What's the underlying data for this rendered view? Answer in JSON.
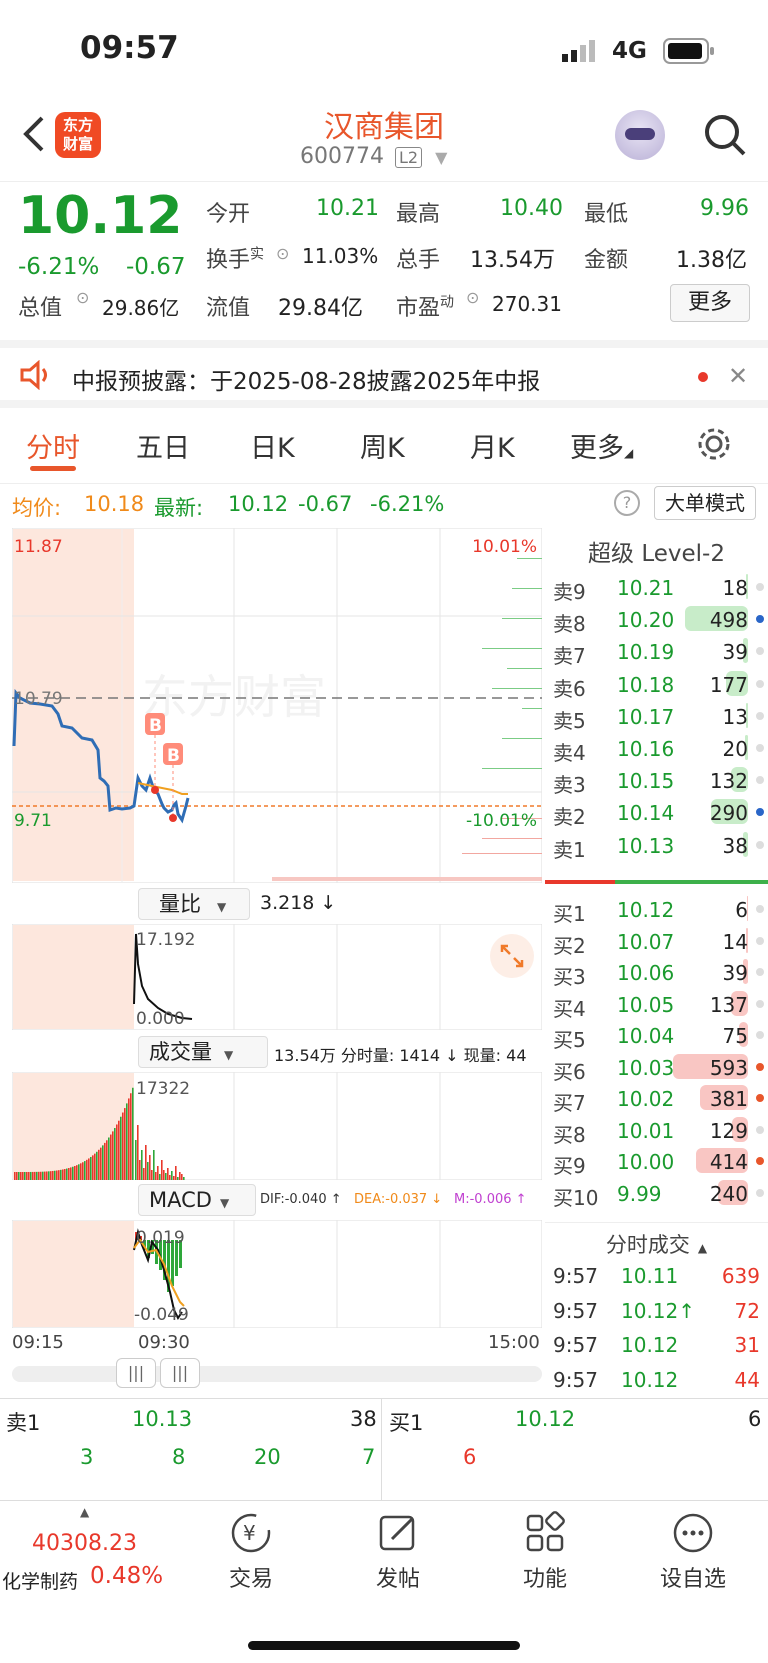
{
  "status": {
    "time": "09:57",
    "network": "4G"
  },
  "header": {
    "title": "汉商集团",
    "code": "600774",
    "badge": "L2",
    "logo_text": "东方财富"
  },
  "quote": {
    "price": "10.12",
    "change_pct": "-6.21%",
    "change": "-0.67",
    "open_label": "今开",
    "open": "10.21",
    "high_label": "最高",
    "high": "10.40",
    "low_label": "最低",
    "low": "9.96",
    "turnover_label": "换手",
    "turnover_sup": "实",
    "turnover": "11.03%",
    "volume_label": "总手",
    "volume": "13.54万",
    "amount_label": "金额",
    "amount": "1.38亿",
    "mktcap_label": "总值",
    "mktcap": "29.86亿",
    "float_label": "流值",
    "float": "29.84亿",
    "pe_label": "市盈",
    "pe_sup": "动",
    "pe": "270.31",
    "more_label": "更多"
  },
  "notice": {
    "text": "中报预披露：于2025-08-28披露2025年中报"
  },
  "tabs": [
    "分时",
    "五日",
    "日K",
    "周K",
    "月K",
    "更多"
  ],
  "avgline": {
    "avg_label": "均价:",
    "avg": "10.18",
    "last_label": "最新:",
    "last": "10.12",
    "chg": "-0.67",
    "pct": "-6.21%",
    "mode_label": "大单模式"
  },
  "chart": {
    "max_price": "11.87",
    "min_price": "9.71",
    "max_pct": "10.01%",
    "min_pct": "-10.01%",
    "ref_price": "10.79",
    "watermark": "东方财富",
    "vr_label": "量比",
    "vr_value": "3.218 ↓",
    "vr_max": "17.192",
    "vr_min": "0.000",
    "vol_label": "成交量",
    "vol_info": "13.54万 分时量: 1414 ↓ 现量: 44",
    "vol_max": "17322",
    "macd_label": "MACD",
    "dif": "DIF:-0.040 ↑",
    "dea": "DEA:-0.037 ↓",
    "m": "M:-0.006 ↑",
    "macd_max": "0.019",
    "macd_min": "-0.049",
    "t_start": "09:15",
    "t_open": "09:30",
    "t_end": "15:00",
    "marker": "B"
  },
  "level2": {
    "title": "超级 Level-2",
    "asks": [
      {
        "label": "卖9",
        "price": "10.21",
        "vol": "18"
      },
      {
        "label": "卖8",
        "price": "10.20",
        "vol": "498"
      },
      {
        "label": "卖7",
        "price": "10.19",
        "vol": "39"
      },
      {
        "label": "卖6",
        "price": "10.18",
        "vol": "177"
      },
      {
        "label": "卖5",
        "price": "10.17",
        "vol": "13"
      },
      {
        "label": "卖4",
        "price": "10.16",
        "vol": "20"
      },
      {
        "label": "卖3",
        "price": "10.15",
        "vol": "132"
      },
      {
        "label": "卖2",
        "price": "10.14",
        "vol": "290"
      },
      {
        "label": "卖1",
        "price": "10.13",
        "vol": "38"
      }
    ],
    "bids": [
      {
        "label": "买1",
        "price": "10.12",
        "vol": "6"
      },
      {
        "label": "买2",
        "price": "10.07",
        "vol": "14"
      },
      {
        "label": "买3",
        "price": "10.06",
        "vol": "39"
      },
      {
        "label": "买4",
        "price": "10.05",
        "vol": "137"
      },
      {
        "label": "买5",
        "price": "10.04",
        "vol": "75"
      },
      {
        "label": "买6",
        "price": "10.03",
        "vol": "593"
      },
      {
        "label": "买7",
        "price": "10.02",
        "vol": "381"
      },
      {
        "label": "买8",
        "price": "10.01",
        "vol": "129"
      },
      {
        "label": "买9",
        "price": "10.00",
        "vol": "414"
      },
      {
        "label": "买10",
        "price": "9.99",
        "vol": "240"
      }
    ],
    "ticks_title": "分时成交",
    "ticks": [
      {
        "time": "9:57",
        "price": "10.11",
        "vol": "639"
      },
      {
        "time": "9:57",
        "price": "10.12↑",
        "vol": "72"
      },
      {
        "time": "9:57",
        "price": "10.12",
        "vol": "31"
      },
      {
        "time": "9:57",
        "price": "10.12",
        "vol": "44"
      }
    ]
  },
  "queue": {
    "ask_label": "卖1",
    "ask_price": "10.13",
    "ask_vol": "38",
    "ask_orders": [
      "3",
      "8",
      "20",
      "7"
    ],
    "bid_label": "买1",
    "bid_price": "10.12",
    "bid_vol": "6",
    "bid_orders": [
      "6"
    ]
  },
  "bottom": {
    "index_value": "40308.23",
    "index_name": "化学制药",
    "index_pct": "0.48%",
    "items": [
      "交易",
      "发帖",
      "功能",
      "设自选"
    ]
  }
}
